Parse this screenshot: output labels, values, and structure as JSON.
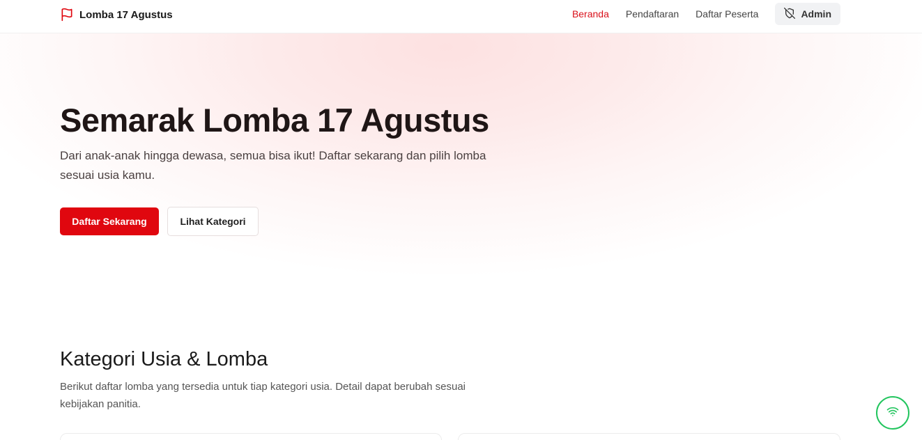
{
  "brand": {
    "name": "Lomba 17 Agustus",
    "icon": "flag-icon",
    "accent": "#e0070f"
  },
  "nav": {
    "links": [
      {
        "label": "Beranda",
        "active": true
      },
      {
        "label": "Pendaftaran",
        "active": false
      },
      {
        "label": "Daftar Peserta",
        "active": false
      }
    ],
    "admin": {
      "label": "Admin",
      "icon": "shield-off-icon"
    }
  },
  "hero": {
    "title": "Semarak Lomba 17 Agustus",
    "description": "Dari anak-anak hingga dewasa, semua bisa ikut! Daftar sekarang dan pilih lomba sesuai usia kamu.",
    "primary_button": "Daftar Sekarang",
    "secondary_button": "Lihat Kategori"
  },
  "categories": {
    "title": "Kategori Usia & Lomba",
    "description": "Berikut daftar lomba yang tersedia untuk tiap kategori usia. Detail dapat berubah sesuai kebijakan panitia."
  },
  "floating_badge": {
    "icon": "wifi-icon",
    "color": "#22c55e"
  }
}
